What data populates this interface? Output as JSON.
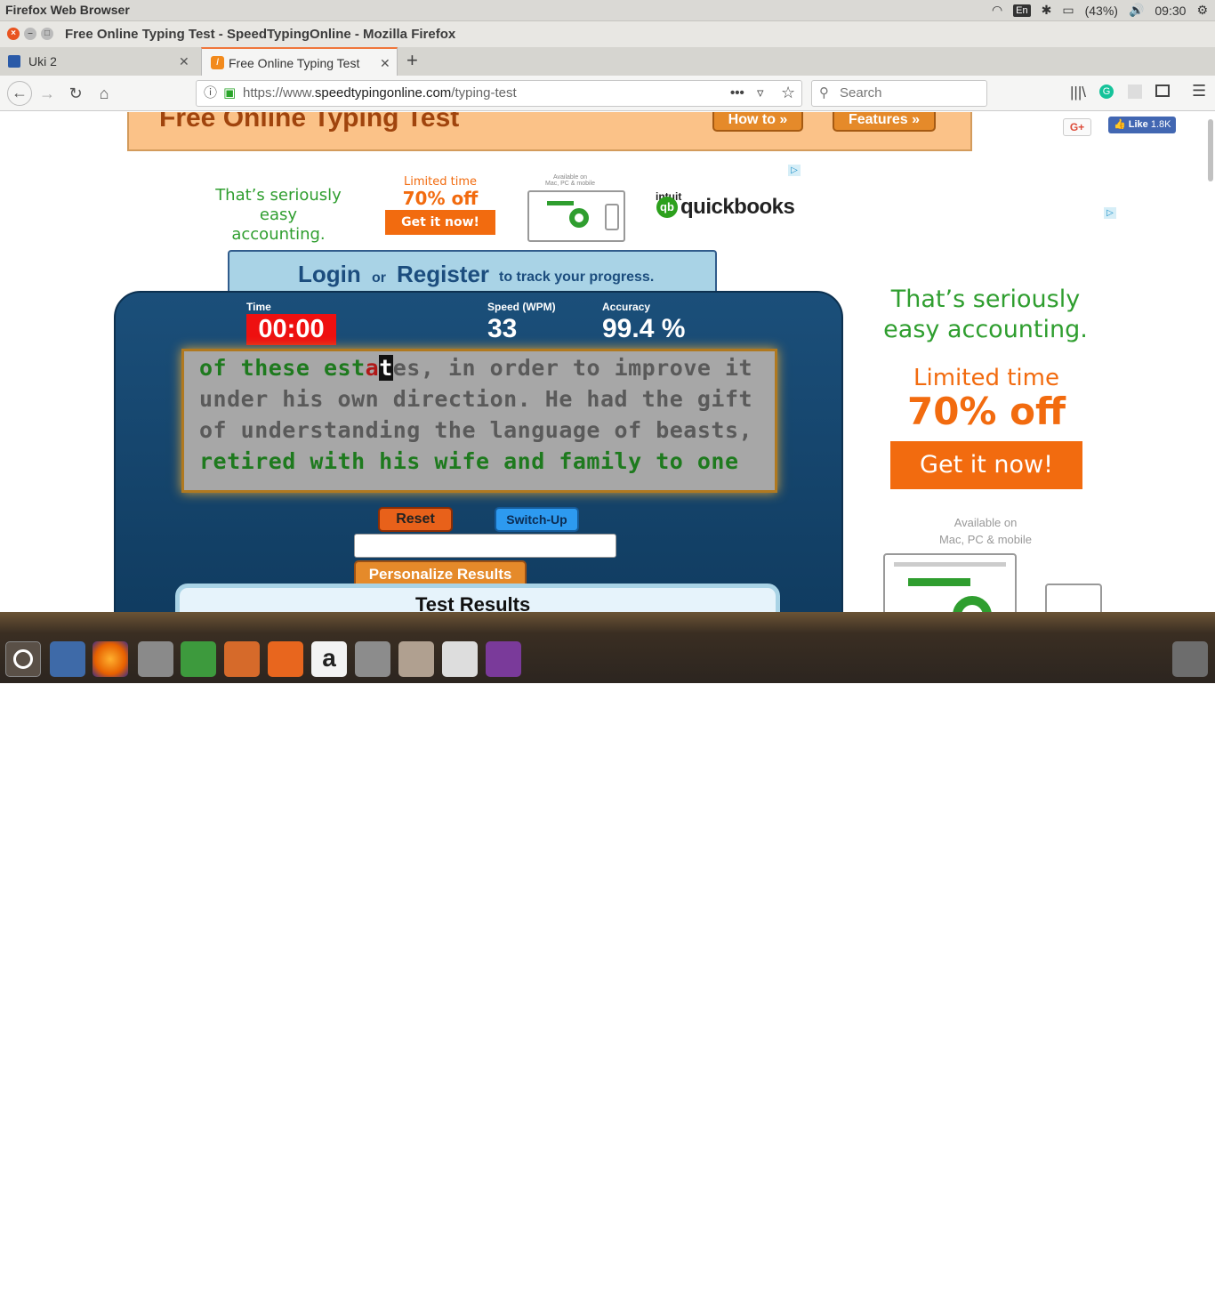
{
  "system": {
    "title": "Firefox Web Browser",
    "keyboard": "En",
    "battery": "(43%)",
    "time": "09:30"
  },
  "window": {
    "title": "Free Online Typing Test - SpeedTypingOnline - Mozilla Firefox"
  },
  "tabs": [
    {
      "label": "Uki 2"
    },
    {
      "label": "Free Online Typing Test"
    }
  ],
  "nav": {
    "url_prefix": "https://www.",
    "url_domain": "speedtypingonline.com",
    "url_path": "/typing-test",
    "search_placeholder": "Search"
  },
  "header": {
    "title": "Free Online Typing Test",
    "howto": "How to »",
    "features": "Features »"
  },
  "social": {
    "gplus": "G+",
    "like": "Like",
    "like_count": "1.8K"
  },
  "ad_top": {
    "line1": "That’s seriously",
    "line2": "easy accounting.",
    "limited": "Limited time",
    "off": "70% off",
    "cta": "Get it now!",
    "avail": "Available on\nMac, PC & mobile",
    "brand_small": "intuit",
    "brand": "quickbooks"
  },
  "login": {
    "login": "Login",
    "or": "or",
    "register": "Register",
    "tail": "to track your progress."
  },
  "stats": {
    "time_label": "Time",
    "time": "00:00",
    "speed_label": "Speed (WPM)",
    "speed": "33",
    "acc_label": "Accuracy",
    "acc": "99.4 %"
  },
  "text": {
    "l1_done": "of these est",
    "l1_err": "a",
    "l1_cur": "t",
    "l1_todo": "es, in order to improve it",
    "l2": "under his own direction. He had the gift",
    "l3": "of understanding the language of beasts,",
    "l4": "retired with his wife and family to one"
  },
  "buttons": {
    "reset": "Reset",
    "switch": "Switch-Up",
    "personalize": "Personalize Results"
  },
  "results": {
    "title": "Test Results"
  },
  "ad_side": {
    "line1": "That’s seriously",
    "line2": "easy accounting.",
    "limited": "Limited time",
    "off": "70% off",
    "cta": "Get it now!",
    "avail1": "Available on",
    "avail2": "Mac, PC & mobile"
  },
  "colors": {
    "accent": "#f0763a",
    "panel": "#1b4f7a",
    "timer": "#e8141a",
    "green": "#2f9e2f",
    "orange": "#f26b0f"
  }
}
